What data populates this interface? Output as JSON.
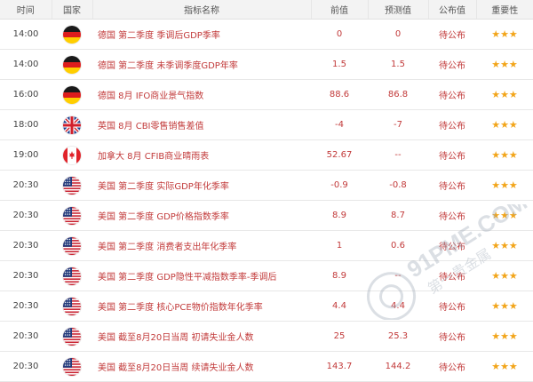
{
  "header": {
    "time": "时间",
    "country": "国家",
    "indicator": "指标名称",
    "previous": "前值",
    "forecast": "预测值",
    "actual": "公布值",
    "importance": "重要性"
  },
  "rows": [
    {
      "time": "14:00",
      "flag": "germany-flag-icon",
      "name": "德国 第二季度 季调后GDP季率",
      "previous": "0",
      "forecast": "0",
      "actual": "待公布",
      "importance": "★★★"
    },
    {
      "time": "14:00",
      "flag": "germany-flag-icon",
      "name": "德国 第二季度 未季调季度GDP年率",
      "previous": "1.5",
      "forecast": "1.5",
      "actual": "待公布",
      "importance": "★★★"
    },
    {
      "time": "16:00",
      "flag": "germany-flag-icon",
      "name": "德国 8月 IFO商业景气指数",
      "previous": "88.6",
      "forecast": "86.8",
      "actual": "待公布",
      "importance": "★★★"
    },
    {
      "time": "18:00",
      "flag": "uk-flag-icon",
      "name": "英国 8月 CBI零售销售差值",
      "previous": "-4",
      "forecast": "-7",
      "actual": "待公布",
      "importance": "★★★"
    },
    {
      "time": "19:00",
      "flag": "canada-flag-icon",
      "name": "加拿大 8月 CFIB商业晴雨表",
      "previous": "52.67",
      "forecast": "--",
      "actual": "待公布",
      "importance": "★★★"
    },
    {
      "time": "20:30",
      "flag": "us-flag-icon",
      "name": "美国 第二季度 实际GDP年化季率",
      "previous": "-0.9",
      "forecast": "-0.8",
      "actual": "待公布",
      "importance": "★★★"
    },
    {
      "time": "20:30",
      "flag": "us-flag-icon",
      "name": "美国 第二季度 GDP价格指数季率",
      "previous": "8.9",
      "forecast": "8.7",
      "actual": "待公布",
      "importance": "★★★"
    },
    {
      "time": "20:30",
      "flag": "us-flag-icon",
      "name": "美国 第二季度 消费者支出年化季率",
      "previous": "1",
      "forecast": "0.6",
      "actual": "待公布",
      "importance": "★★★"
    },
    {
      "time": "20:30",
      "flag": "us-flag-icon",
      "name": "美国 第二季度 GDP隐性平减指数季率-季调后",
      "previous": "8.9",
      "forecast": "--",
      "actual": "待公布",
      "importance": "★★★"
    },
    {
      "time": "20:30",
      "flag": "us-flag-icon",
      "name": "美国 第二季度 核心PCE物价指数年化季率",
      "previous": "4.4",
      "forecast": "4.4",
      "actual": "待公布",
      "importance": "★★★"
    },
    {
      "time": "20:30",
      "flag": "us-flag-icon",
      "name": "美国 截至8月20日当周 初请失业金人数",
      "previous": "25",
      "forecast": "25.3",
      "actual": "待公布",
      "importance": "★★★"
    },
    {
      "time": "20:30",
      "flag": "us-flag-icon",
      "name": "美国 截至8月20日当周 续请失业金人数",
      "previous": "143.7",
      "forecast": "144.2",
      "actual": "待公布",
      "importance": "★★★"
    }
  ],
  "watermark": {
    "url": "91PME.COM",
    "sub": "第一贵金属"
  },
  "colors": {
    "accent": "#c23a3a",
    "star": "#f2a51a",
    "header_bg": "#f3f3f3"
  }
}
